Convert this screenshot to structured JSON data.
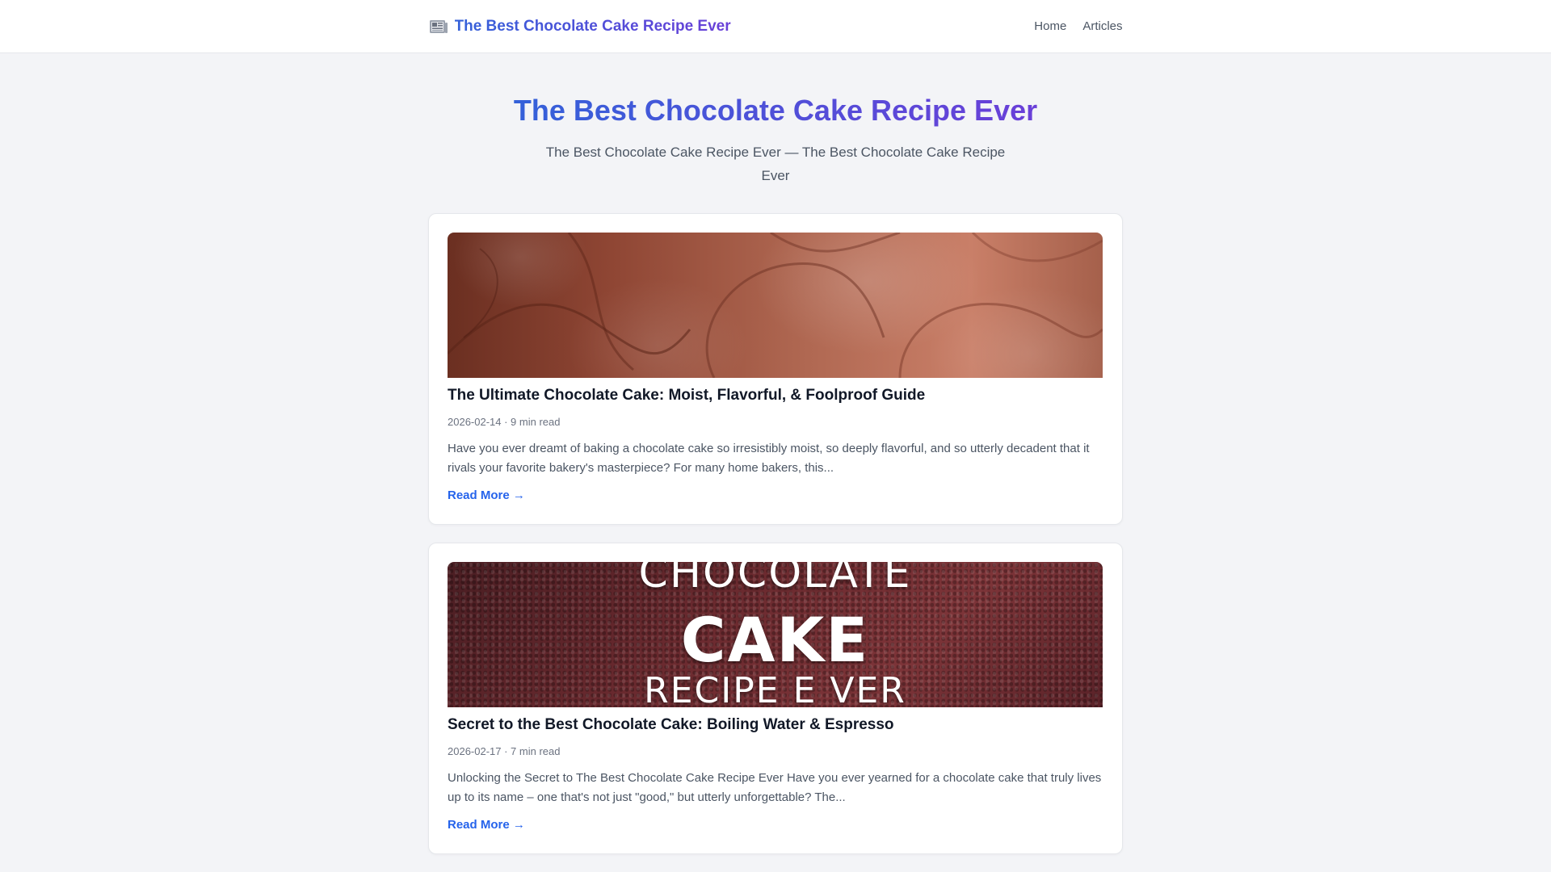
{
  "header": {
    "brand_icon": "newspaper-icon",
    "brand_title": "The Best Chocolate Cake Recipe Ever",
    "nav": [
      {
        "label": "Home"
      },
      {
        "label": "Articles"
      }
    ]
  },
  "hero": {
    "title": "The Best Chocolate Cake Recipe Ever",
    "subtitle": "The Best Chocolate Cake Recipe Ever — The Best Chocolate Cake Recipe Ever"
  },
  "articles": [
    {
      "image": "chocolate-frosting-closeup",
      "title": "The Ultimate Chocolate Cake: Moist, Flavorful, & Foolproof Guide",
      "meta": "2026-02-14 · 9 min read",
      "excerpt": "Have you ever dreamt of baking a chocolate cake so irresistibly moist, so deeply flavorful, and so utterly decadent that it rivals your favorite bakery's masterpiece? For many home bakers, this...",
      "cta": "Read More →"
    },
    {
      "image": "chocolate-cake-crumb",
      "image_text": [
        "CHOCOLATE",
        "CAKE",
        "RECIPE E VER"
      ],
      "title": "Secret to the Best Chocolate Cake: Boiling Water & Espresso",
      "meta": "2026-02-17 · 7 min read",
      "excerpt": "Unlocking the Secret to The Best Chocolate Cake Recipe Ever Have you ever yearned for a chocolate cake that truly lives up to its name – one that's not just \"good,\" but utterly unforgettable? The...",
      "cta": "Read More →"
    }
  ],
  "colors": {
    "brand_gradient_start": "#3461d9",
    "brand_gradient_end": "#6a3fd8",
    "link": "#2563eb",
    "background": "#f3f4f7"
  }
}
